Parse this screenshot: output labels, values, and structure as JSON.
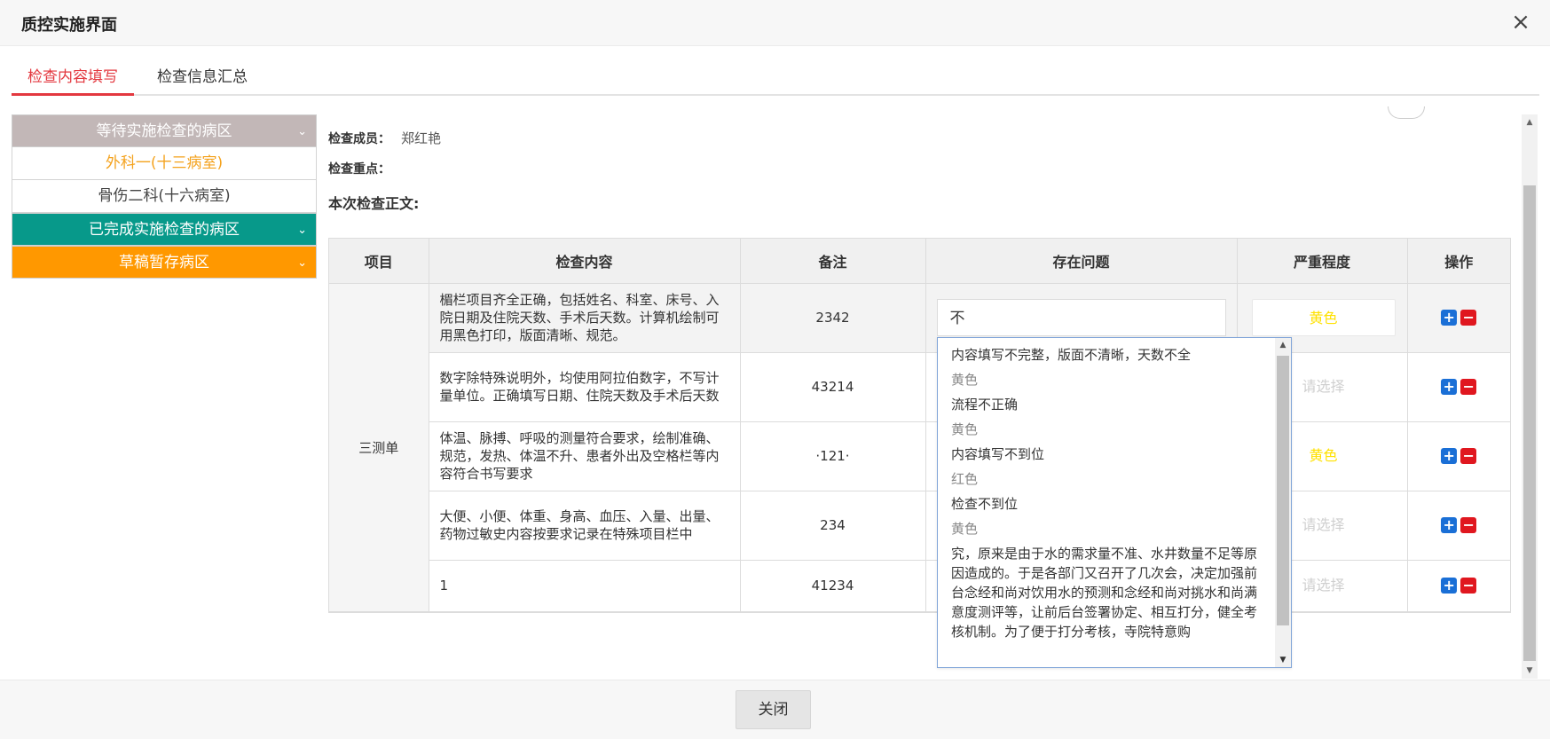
{
  "dialog": {
    "title": "质控实施界面",
    "close_glyph": "×"
  },
  "tabs": [
    {
      "label": "检查内容填写"
    },
    {
      "label": "检查信息汇总"
    }
  ],
  "sidebar": {
    "pending_header": "等待实施检查的病区",
    "pending_items": [
      {
        "label": "外科一(十三病室)"
      },
      {
        "label": "骨伤二科(十六病室)"
      }
    ],
    "done_header": "已完成实施检查的病区",
    "draft_header": "草稿暂存病区"
  },
  "info": {
    "members_label": "检查成员：",
    "members_value": "郑红艳",
    "focus_label": "检查重点：",
    "body_label": "本次检查正文:"
  },
  "table": {
    "headers": [
      "项目",
      "检查内容",
      "备注",
      "存在问题",
      "严重程度",
      "操作"
    ],
    "group_label": "三测单",
    "rows": [
      {
        "content": "楣栏项目齐全正确，包括姓名、科室、床号、入院日期及住院天数、手术后天数。计算机绘制可用黑色打印，版面清晰、规范。",
        "note": "2342",
        "issue": "不",
        "severity": "黄色"
      },
      {
        "content": "数字除特殊说明外，均使用阿拉伯数字，不写计量单位。正确填写日期、住院天数及手术后天数",
        "note": "43214",
        "issue": "",
        "severity": "请选择"
      },
      {
        "content": "体温、脉搏、呼吸的测量符合要求，绘制准确、规范，发热、体温不升、患者外出及空格栏等内容符合书写要求",
        "note": "·121·",
        "issue": "",
        "severity": "黄色"
      },
      {
        "content": "大便、小便、体重、身高、血压、入量、出量、药物过敏史内容按要求记录在特殊项目栏中",
        "note": "234",
        "issue": "",
        "severity": "请选择"
      },
      {
        "content": "1",
        "note": "41234",
        "issue": "",
        "severity": "请选择"
      }
    ]
  },
  "dropdown": {
    "options": [
      {
        "text": "内容填写不完整，版面不清晰，天数不全",
        "level": "黄色"
      },
      {
        "text": "流程不正确",
        "level": "黄色"
      },
      {
        "text": "内容填写不到位",
        "level": "红色"
      },
      {
        "text": "检查不到位",
        "level": "黄色"
      }
    ],
    "long_text": "究，原来是由于水的需求量不准、水井数量不足等原因造成的。于是各部门又召开了几次会，决定加强前台念经和尚对饮用水的预测和念经和尚对挑水和尚满意度测评等，让前后台签署协定、相互打分，健全考核机制。为了便于打分考核，寺院特意购"
  },
  "footer": {
    "close_label": "关闭"
  },
  "colors": {
    "accent_red": "#e3383f",
    "teal": "#07998a",
    "orange": "#ff9800",
    "pending_grey": "#c2b7b7",
    "selected_orange": "#f4a21d",
    "yellow_text": "#ffe100"
  },
  "icons": [
    "close-icon",
    "chevron-down-icon",
    "plus-icon",
    "minus-icon",
    "scroll-up-icon",
    "scroll-down-icon"
  ]
}
